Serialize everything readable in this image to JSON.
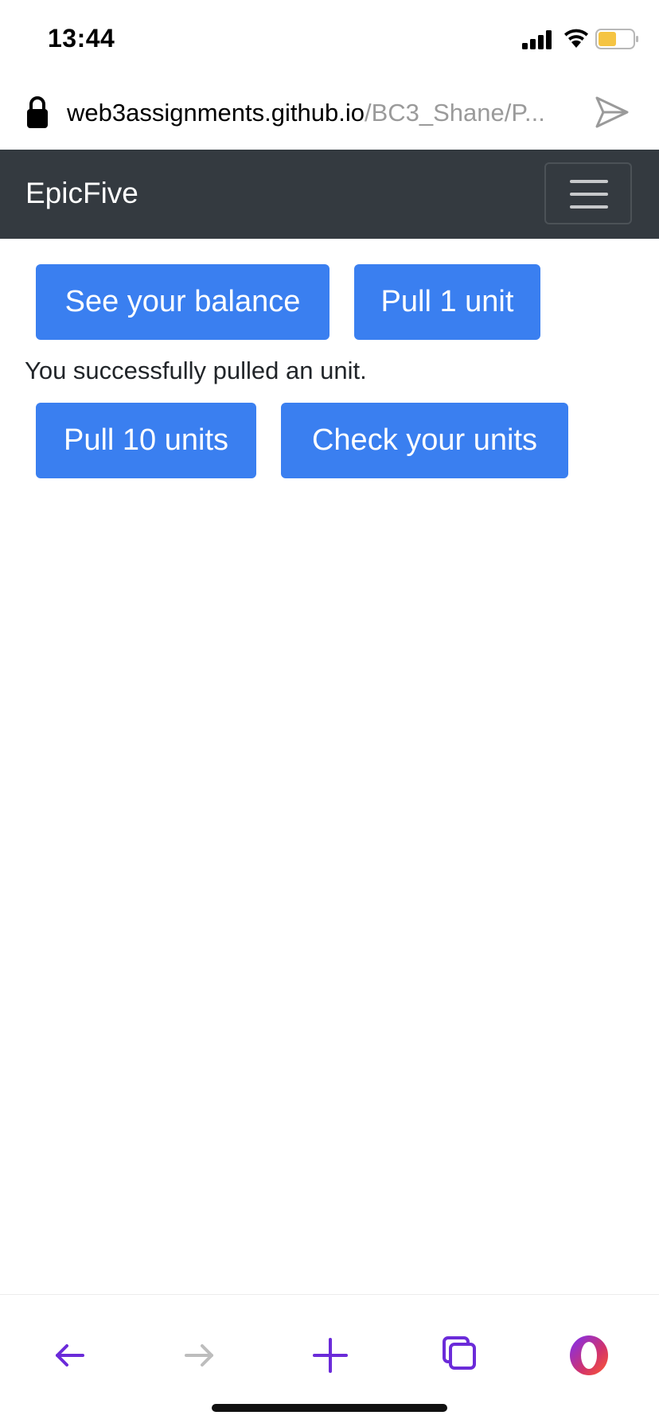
{
  "status_bar": {
    "time": "13:44",
    "icons": [
      "signal-icon",
      "wifi-icon",
      "battery-icon"
    ],
    "battery_color": "#f5c443"
  },
  "browser": {
    "url_host": "web3assignments.github.io",
    "url_path": "/BC3_Shane/P...",
    "icons": [
      "lock-icon",
      "send-icon"
    ]
  },
  "navbar": {
    "brand": "EpicFive",
    "background": "#343a40",
    "toggler_icon": "hamburger-icon"
  },
  "main": {
    "buttons_row1": {
      "see_balance": "See your balance",
      "pull_one": "Pull 1 unit"
    },
    "message": "You successfully pulled an unit.",
    "buttons_row2": {
      "pull_ten": "Pull 10 units",
      "check_units": "Check your units"
    },
    "button_color": "#3a7ff0"
  },
  "bottom_toolbar": {
    "items": [
      "back-arrow-icon",
      "forward-arrow-icon",
      "new-tab-plus-icon",
      "tabs-icon",
      "opera-menu-icon"
    ],
    "accent": "#6b2bd9"
  }
}
